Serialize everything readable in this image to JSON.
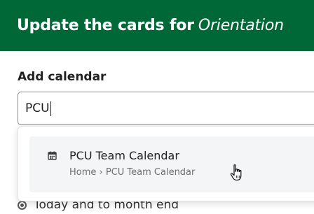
{
  "header": {
    "title_prefix": "Update the cards for",
    "title_subject": "Orientation",
    "background_color": "#006837"
  },
  "calendar_field": {
    "label": "Add calendar",
    "value": "PCU"
  },
  "suggestions": [
    {
      "icon": "calendar-icon",
      "title": "PCU Team Calendar",
      "path": "Home › PCU Team Calendar"
    }
  ],
  "options": {
    "range_label": "Today and to month end"
  },
  "cursor": "hand-pointer-icon"
}
